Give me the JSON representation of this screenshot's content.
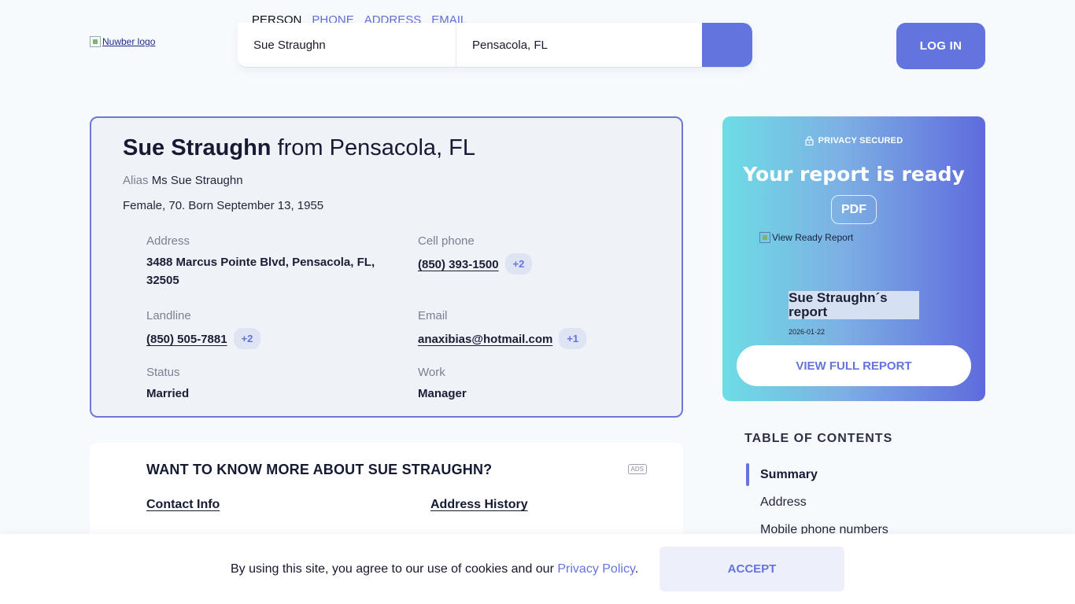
{
  "header": {
    "logo_alt": "Nuwber logo",
    "search_tabs": [
      "PERSON",
      "PHONE",
      "ADDRESS",
      "EMAIL"
    ],
    "name_value": "Sue Straughn",
    "location_value": "Pensacola, FL",
    "login_label": "LOG IN"
  },
  "profile": {
    "name": "Sue Straughn",
    "from_text": "from Pensacola, FL",
    "alias_label": "Alias",
    "alias_value": "Ms Sue Straughn",
    "bio": "Female, 70. Born September 13, 1955",
    "address_label": "Address",
    "address_value": "3488 Marcus Pointe Blvd, Pensacola, FL, 32505",
    "cell_label": "Cell phone",
    "cell_value": "(850) 393-1500",
    "cell_more": "+2",
    "landline_label": "Landline",
    "landline_value": "(850) 505-7881",
    "landline_more": "+2",
    "email_label": "Email",
    "email_value": "anaxibias@hotmail.com",
    "email_more": "+1",
    "status_label": "Status",
    "status_value": "Married",
    "work_label": "Work",
    "work_value": "Manager"
  },
  "more": {
    "heading": "WANT TO KNOW MORE ABOUT SUE STRAUGHN?",
    "ads": "ADS",
    "links": [
      "Contact Info",
      "Address History"
    ]
  },
  "report": {
    "privacy": "PRIVACY SECURED",
    "headline": "Your report is ready",
    "pdf": "PDF",
    "image_alt": "View Ready Report",
    "doc_name": "Sue Straughn´s report",
    "doc_date": "2026-01-22",
    "button": "VIEW FULL REPORT"
  },
  "toc": {
    "title": "TABLE OF CONTENTS",
    "items": [
      "Summary",
      "Address",
      "Mobile phone numbers"
    ]
  },
  "cookie": {
    "text": "By using this site, you agree to our use of cookies and our",
    "policy": "Privacy Policy",
    "period": ".",
    "accept": "ACCEPT"
  },
  "colors": {
    "accent": "#6374de",
    "card_border": "#6c78d6",
    "gradient_start": "#6ddde5",
    "gradient_end": "#5f6bdd"
  }
}
